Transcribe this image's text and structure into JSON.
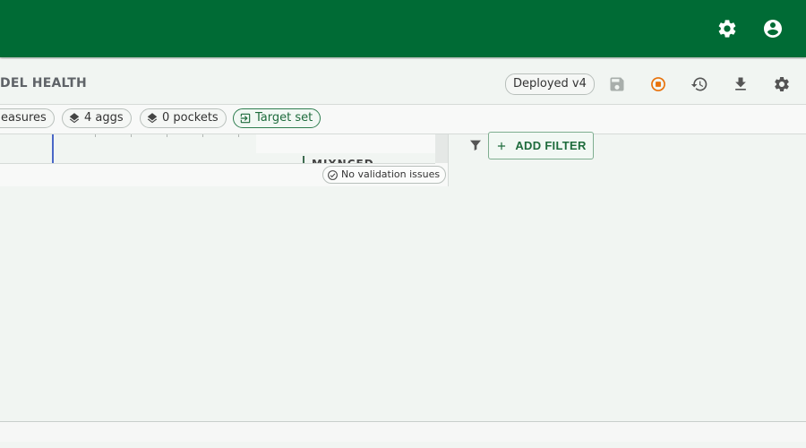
{
  "header": {
    "icons": [
      "gear-icon",
      "account-circle-icon"
    ],
    "brand_color": "#006b35"
  },
  "subheader": {
    "title": "DEL HEALTH",
    "deployed_badge": "Deployed v4",
    "tools": [
      "save-icon",
      "stop-circle-icon",
      "history-icon",
      "download-icon",
      "settings-icon"
    ],
    "stop_color": "#e8710a"
  },
  "chips": {
    "measures": "easures",
    "aggs": "4 aggs",
    "pockets": "0 pockets",
    "target": "Target set"
  },
  "canvas": {
    "node_label": "MIXNCED",
    "validation": "No validation issues"
  },
  "filters": {
    "add_filter_label": "ADD FILTER"
  }
}
